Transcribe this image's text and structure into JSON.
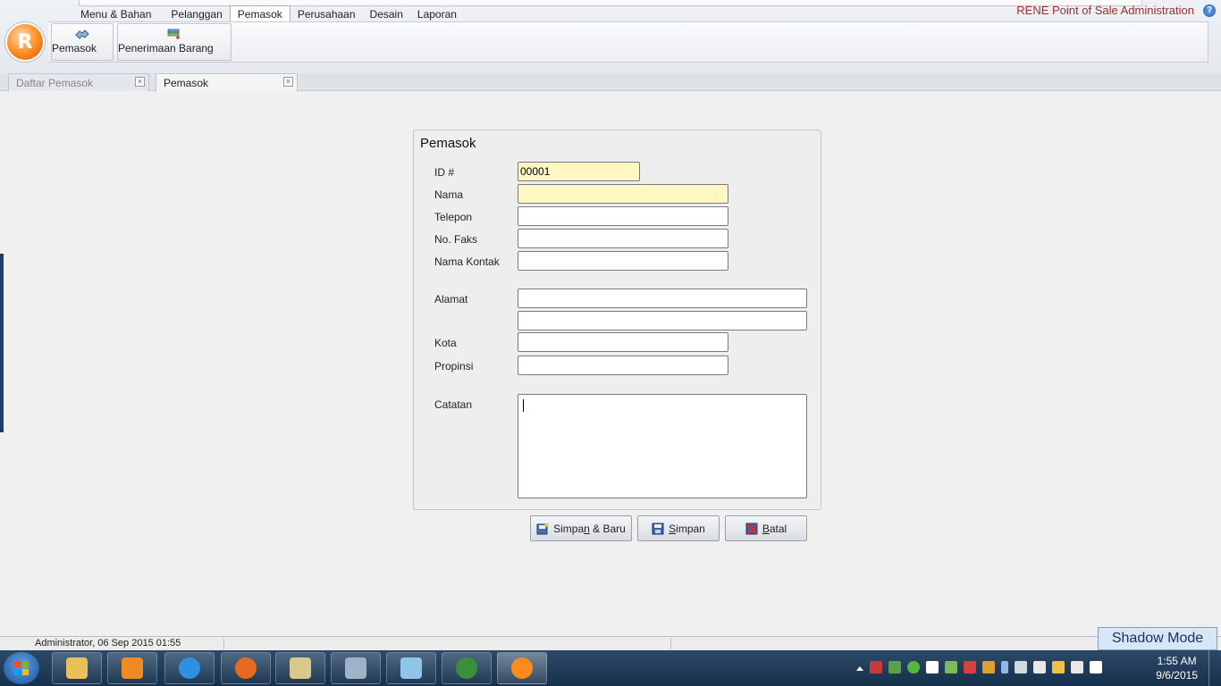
{
  "app": {
    "title": "RENE Point of Sale Administration",
    "orb_letter": "R",
    "help": "?"
  },
  "ribbon": {
    "tabs": [
      {
        "label": "Menu & Bahan"
      },
      {
        "label": "Pelanggan"
      },
      {
        "label": "Pemasok"
      },
      {
        "label": "Perusahaan"
      },
      {
        "label": "Desain"
      },
      {
        "label": "Laporan"
      }
    ],
    "active_tab": "Pemasok",
    "buttons": [
      {
        "label": "Pemasok",
        "icon": "supplier-icon"
      },
      {
        "label": "Penerimaan Barang",
        "icon": "receive-goods-icon"
      }
    ]
  },
  "doc_tabs": [
    {
      "label": "Daftar Pemasok",
      "active": false
    },
    {
      "label": "Pemasok",
      "active": true
    }
  ],
  "form": {
    "title": "Pemasok",
    "fields": {
      "id": {
        "label": "ID #",
        "value": "00001"
      },
      "nama": {
        "label": "Nama",
        "value": ""
      },
      "telepon": {
        "label": "Telepon",
        "value": ""
      },
      "faks": {
        "label": "No. Faks",
        "value": ""
      },
      "kontak": {
        "label": "Nama Kontak",
        "value": ""
      },
      "alamat": {
        "label": "Alamat",
        "value1": "",
        "value2": ""
      },
      "kota": {
        "label": "Kota",
        "value": ""
      },
      "propinsi": {
        "label": "Propinsi",
        "value": ""
      },
      "catatan": {
        "label": "Catatan",
        "value": ""
      }
    },
    "highlight_color": "#fff7c3"
  },
  "actions": {
    "save_new": {
      "label_pre": "Simpa",
      "label_u": "n",
      "label_post": " & Baru",
      "icon": "save-new-icon"
    },
    "save": {
      "label_u": "S",
      "label_post": "impan",
      "icon": "floppy-icon"
    },
    "cancel": {
      "label_u": "B",
      "label_post": "atal",
      "icon": "cancel-icon"
    }
  },
  "status": {
    "text": "Administrator, 06 Sep 2015  01:55",
    "shadow_mode": "Shadow Mode"
  },
  "taskbar": {
    "apps": [
      {
        "name": "file-explorer-icon",
        "color": "#e8c15a"
      },
      {
        "name": "media-player-icon",
        "color": "#f08a24"
      },
      {
        "name": "internet-explorer-icon",
        "color": "#2f8fe0"
      },
      {
        "name": "firefox-icon",
        "color": "#e66a1f"
      },
      {
        "name": "notepad-edit-icon",
        "color": "#d8c98a"
      },
      {
        "name": "window-app-icon",
        "color": "#9fb3c8"
      },
      {
        "name": "sticky-app-icon",
        "color": "#8ec5e8"
      },
      {
        "name": "globe-icon",
        "color": "#3b8f3b"
      },
      {
        "name": "rene-pos-icon",
        "color": "#ff8a1d"
      }
    ],
    "time": "1:55 AM",
    "date": "9/6/2015"
  }
}
